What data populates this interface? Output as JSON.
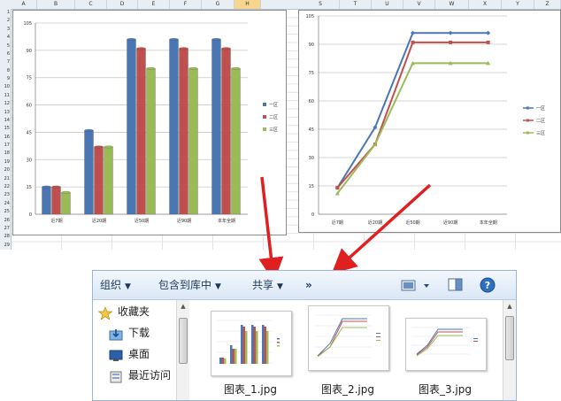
{
  "spreadsheet": {
    "columns": [
      "A",
      "B",
      "C",
      "D",
      "E",
      "F",
      "G",
      "H",
      "S",
      "T",
      "U",
      "V",
      "W",
      "X",
      "Y",
      "Z"
    ],
    "selected_column": "H",
    "rows": [
      "1",
      "2",
      "3",
      "4",
      "5",
      "6",
      "7",
      "8",
      "9",
      "10",
      "11",
      "12",
      "13",
      "14",
      "15",
      "16",
      "17",
      "18",
      "19",
      "20",
      "21",
      "22",
      "23",
      "24",
      "25",
      "26",
      "27",
      "28",
      "29"
    ]
  },
  "chart_data": [
    {
      "type": "bar",
      "categories": [
        "近7期",
        "近20期",
        "近50期",
        "近90期",
        "本年全期"
      ],
      "series": [
        {
          "name": "一区",
          "values": [
            15,
            46,
            96,
            96,
            96
          ],
          "color": "#4a76b6"
        },
        {
          "name": "二区",
          "values": [
            15,
            37,
            91,
            91,
            91
          ],
          "color": "#c0504d"
        },
        {
          "name": "三区",
          "values": [
            12,
            37,
            80,
            80,
            80
          ],
          "color": "#9bbb59"
        }
      ],
      "ylim": [
        0,
        105
      ],
      "yticks": [
        "0",
        "15",
        "30",
        "45",
        "60",
        "75",
        "90",
        "105"
      ],
      "grid": true,
      "legend": "right"
    },
    {
      "type": "line",
      "categories": [
        "近7期",
        "近20期",
        "近50期",
        "近90期",
        "本年全期"
      ],
      "series": [
        {
          "name": "一区",
          "values": [
            14,
            46,
            96,
            96,
            96
          ],
          "color": "#4a76b6"
        },
        {
          "name": "二区",
          "values": [
            14,
            37,
            91,
            91,
            91
          ],
          "color": "#c0504d"
        },
        {
          "name": "三区",
          "values": [
            11,
            37,
            80,
            80,
            80
          ],
          "color": "#9bbb59"
        }
      ],
      "ylim": [
        0,
        105
      ],
      "yticks": [
        "0",
        "15",
        "30",
        "45",
        "60",
        "75",
        "90",
        "105"
      ],
      "grid": true,
      "legend": "right"
    }
  ],
  "explorer": {
    "toolbar": {
      "organize": "组织",
      "include_in_library": "包含到库中",
      "share": "共享",
      "more": "»"
    },
    "nav": {
      "favorites": "收藏夹",
      "downloads": "下载",
      "desktop": "桌面",
      "recent": "最近访问"
    },
    "files": [
      {
        "name": "图表_1.jpg"
      },
      {
        "name": "图表_2.jpg"
      },
      {
        "name": "图表_3.jpg"
      }
    ]
  },
  "colors": {
    "arrow": "#e02020",
    "toolbar_text": "#1e395b"
  }
}
